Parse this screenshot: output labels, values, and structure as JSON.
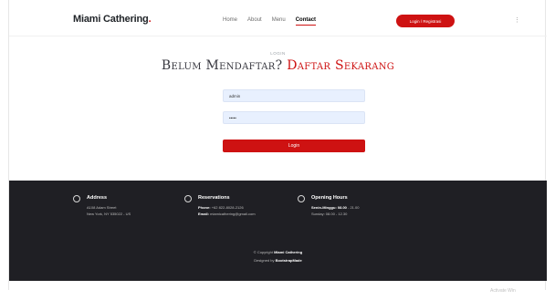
{
  "header": {
    "brand": "Miami Cathering",
    "brand_dot": ".",
    "nav": [
      "Home",
      "About",
      "Menu",
      "Contact"
    ],
    "active_nav": "Contact",
    "login_register_label": "Login / Registrasi",
    "kebab": "⋮"
  },
  "main": {
    "section_label": "LOGIN",
    "headline_main": "Belum Mendaftar? ",
    "headline_accent": "Daftar Sekarang",
    "username_value": "admin",
    "password_value": "•••••",
    "submit_label": "Login"
  },
  "footer": {
    "address": {
      "title": "Address",
      "line1": "A108 Adam Street",
      "line2": "New York, NY 535022 - US"
    },
    "reservations": {
      "title": "Reservations",
      "phone_label": "Phone:",
      "phone_value": "+62 822-8028-2126",
      "email_label": "Email:",
      "email_value": "miamicathering@gmail.com"
    },
    "hours": {
      "title": "Opening Hours",
      "line1_label": "Senin-Minggu: 08.00",
      "line1_value": " - 21.00",
      "line2": "Sunday: 08.00 - 12.30"
    },
    "copyright_prefix": "© Copyright ",
    "copyright_brand": "Miami Cathering",
    "designed_prefix": "Designed by ",
    "designed_by": "BootstrapMade"
  },
  "watermark": "Activate Win"
}
